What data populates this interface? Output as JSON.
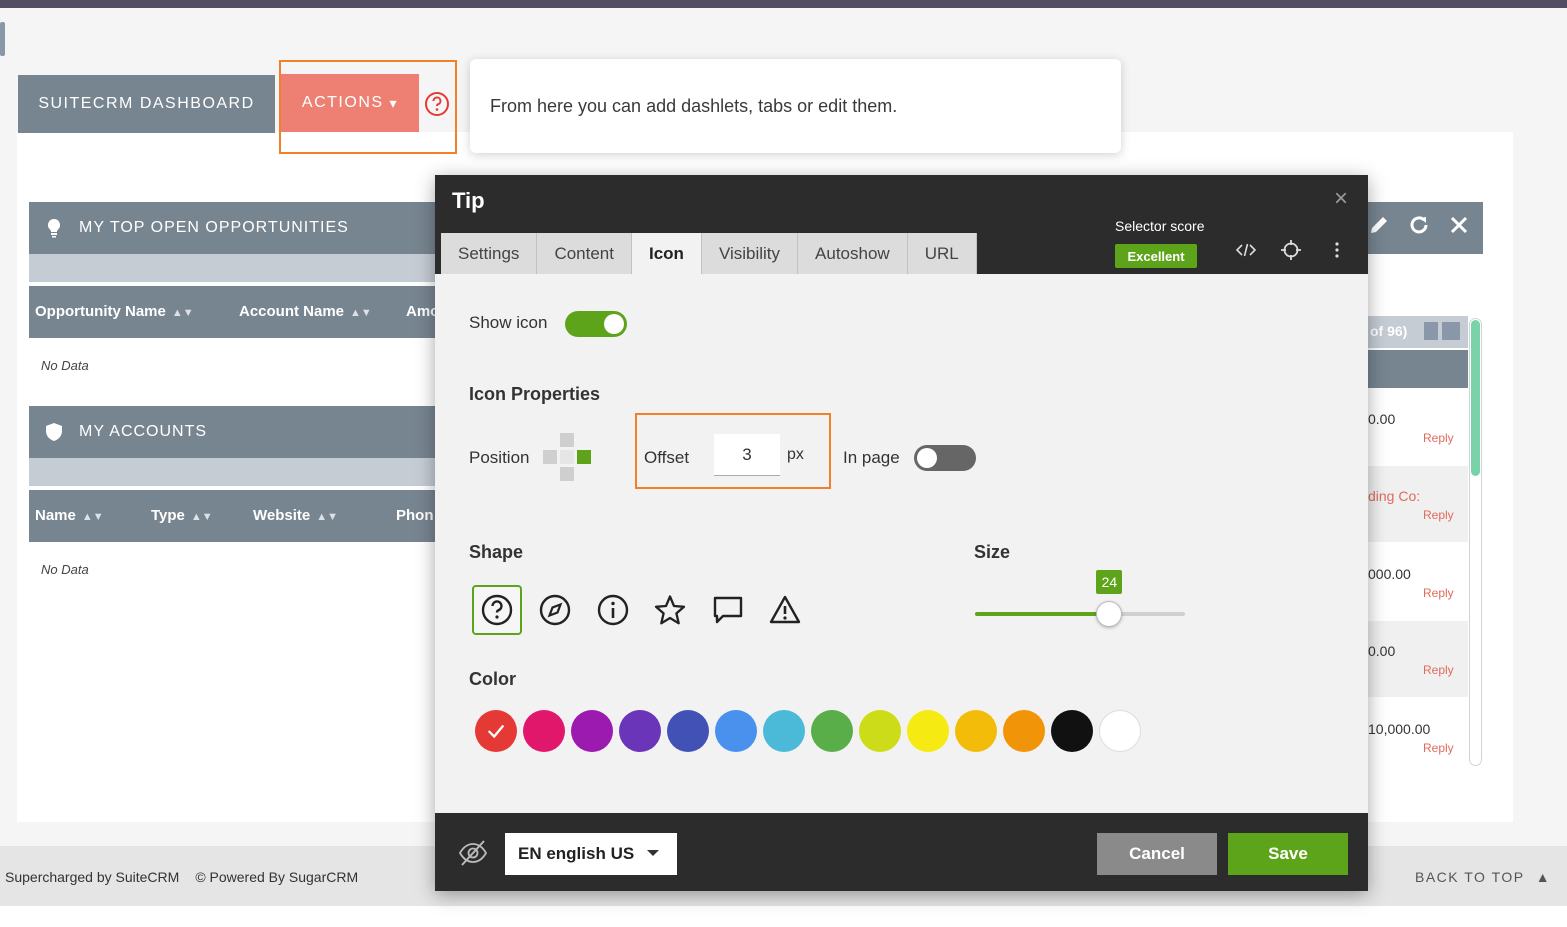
{
  "dashboard": {
    "tab_label": "SUITECRM DASHBOARD",
    "actions_label": "ACTIONS",
    "actions_caret": "▾"
  },
  "tooltip": {
    "text": "From here you can add dashlets, tabs or edit them."
  },
  "dashlets": [
    {
      "title": "MY TOP OPEN OPPORTUNITIES",
      "columns": [
        "Opportunity Name",
        "Account Name",
        "Amo"
      ],
      "empty_text": "No Data"
    },
    {
      "title": "MY ACCOUNTS",
      "columns": [
        "Name",
        "Type",
        "Website",
        "Phon"
      ],
      "empty_text": "No Data"
    }
  ],
  "right_dashlet": {
    "pager_text": "of 96)",
    "rows": [
      {
        "value": "0.00",
        "reply": "Reply"
      },
      {
        "value": "ding Co:",
        "reply": "Reply"
      },
      {
        "value": "000.00",
        "reply": "Reply"
      },
      {
        "value": "0.00",
        "reply": "Reply"
      },
      {
        "value": "10,000.00",
        "reply": "Reply"
      }
    ]
  },
  "footer": {
    "supercharged": "Supercharged by SuiteCRM",
    "powered": "© Powered By SugarCRM",
    "back_to_top": "BACK TO TOP"
  },
  "modal": {
    "title": "Tip",
    "close_glyph": "×",
    "tabs": [
      "Settings",
      "Content",
      "Icon",
      "Visibility",
      "Autoshow",
      "URL"
    ],
    "active_tab": "Icon",
    "selector_score_label": "Selector score",
    "selector_score_value": "Excellent",
    "show_icon_label": "Show icon",
    "show_icon_on": true,
    "icon_properties_label": "Icon Properties",
    "position_label": "Position",
    "offset_label": "Offset",
    "offset_value": "3",
    "offset_unit": "px",
    "in_page_label": "In page",
    "in_page_on": false,
    "shape_label": "Shape",
    "shapes": [
      "question-circle-icon",
      "compass-icon",
      "info-circle-icon",
      "star-icon",
      "chat-bubble-icon",
      "warning-triangle-icon"
    ],
    "selected_shape": "question-circle-icon",
    "size_label": "Size",
    "size_value": "24",
    "size_fraction": 0.64,
    "color_label": "Color",
    "colors": [
      "#e53935",
      "#e0176b",
      "#9c1ab0",
      "#6a35b8",
      "#4251b5",
      "#4a90ed",
      "#4bbad8",
      "#5aae4a",
      "#cddc19",
      "#f5ea12",
      "#f2bc09",
      "#f29407",
      "#111111",
      "#ffffff"
    ],
    "selected_color": "#e53935",
    "language": "EN english US",
    "cancel_label": "Cancel",
    "save_label": "Save"
  }
}
